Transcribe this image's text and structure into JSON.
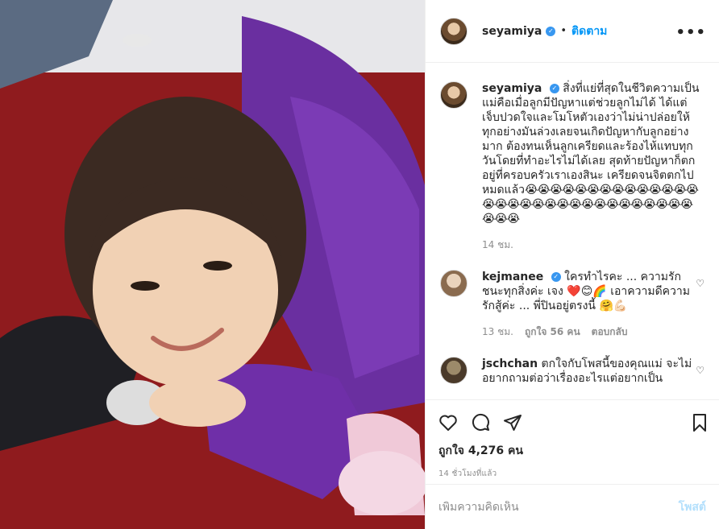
{
  "post": {
    "username": "seyamiya",
    "follow_label": "ติดตาม",
    "more_label": "•••",
    "caption": "สิ่งที่แย่ที่สุดในชีวิตความเป็นแม่คือเมื่อลูกมีปัญหาแต่ช่วยลูกไม่ได้ ได้แต่เจ็บปวดใจและโมโหตัวเองว่าไม่น่าปล่อยให้ทุกอย่างมันล่วงเลยจนเกิดปัญหากับลูกอย่างมาก ต้องทนเห็นลูกเครียดและร้องไห้แทบทุกวันโดยที่ทำอะไรไม่ได้เลย สุดท้ายปัญหาก็ตกอยู่ที่ครอบครัวเราเองสินะ เครียดจนจิตตกไปหมดแล้ว",
    "caption_emoji": "😭😭😭😭😭😭😭😭😭😭😭😭😭😭😭😭😭😭😭😭😭😭😭😭😭😭😭😭😭😭😭😭😭😭",
    "caption_time": "14 ชม."
  },
  "comments": [
    {
      "username": "kejmanee",
      "text": "ใครทำไรคะ ... ความรักชนะทุกสิ่งค่ะ เจง ❤️😊🌈 เอาความดีความรักสู้ค่ะ ... พี่ปินอยู่ตรงนี้ 🤗💪🏻",
      "time": "13 ชม.",
      "likes": "ถูกใจ 56 คน",
      "reply": "ตอบกลับ"
    },
    {
      "username": "jschchan",
      "text": "ตกใจกับโพสนี้ของคุณแม่ จะไม่อยากถามต่อว่าเรื่องอะไรแต่อยากเป็น"
    }
  ],
  "actions": {
    "likes_count": "ถูกใจ 4,276 คน",
    "timestamp": "14 ชั่วโมงที่แล้ว"
  },
  "comment_box": {
    "placeholder": "เพิ่มความคิดเห็น",
    "post_label": "โพสต์"
  },
  "icons": {
    "like": "heart-icon",
    "comment": "comment-icon",
    "share": "share-icon",
    "save": "bookmark-icon"
  }
}
